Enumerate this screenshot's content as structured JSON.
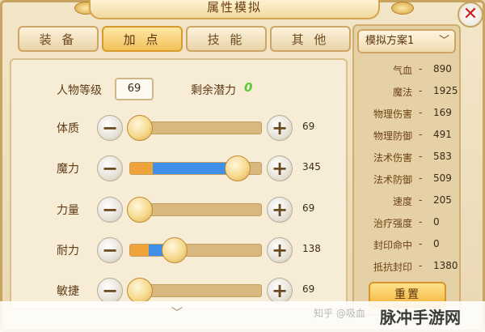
{
  "window": {
    "title": "属性模拟"
  },
  "tabs": [
    "装 备",
    "加 点",
    "技 能",
    "其 他"
  ],
  "main": {
    "level_label": "人物等级",
    "level_value": "69",
    "potential_label": "剩余潜力",
    "potential_value": "0",
    "attributes": [
      {
        "label": "体质",
        "value": "69",
        "orange": 0,
        "blue": 0,
        "knob": 0.08
      },
      {
        "label": "魔力",
        "value": "345",
        "orange": 0.17,
        "blue": 0.56,
        "knob": 0.82
      },
      {
        "label": "力量",
        "value": "69",
        "orange": 0,
        "blue": 0,
        "knob": 0.08
      },
      {
        "label": "耐力",
        "value": "138",
        "orange": 0.14,
        "blue": 0.17,
        "knob": 0.34
      },
      {
        "label": "敏捷",
        "value": "69",
        "orange": 0,
        "blue": 0,
        "knob": 0.08
      }
    ]
  },
  "side": {
    "plan_label": "模拟方案1",
    "stats": [
      {
        "label": "气血",
        "value": "890"
      },
      {
        "label": "魔法",
        "value": "1925"
      },
      {
        "label": "物理伤害",
        "value": "169"
      },
      {
        "label": "物理防御",
        "value": "491"
      },
      {
        "label": "法术伤害",
        "value": "583"
      },
      {
        "label": "法术防御",
        "value": "509"
      },
      {
        "label": "速度",
        "value": "205"
      },
      {
        "label": "治疗强度",
        "value": "0"
      },
      {
        "label": "封印命中",
        "value": "0"
      },
      {
        "label": "抵抗封印",
        "value": "1380"
      }
    ],
    "reset_label": "重置"
  },
  "watermarks": {
    "zhihu": "知乎 @吸血",
    "site": "脉冲手游网"
  },
  "icons": {
    "close": "close-icon",
    "chevron": "chevron-down-icon",
    "minus": "minus-icon",
    "plus": "plus-icon",
    "scroll": "chevron-down-icon"
  }
}
